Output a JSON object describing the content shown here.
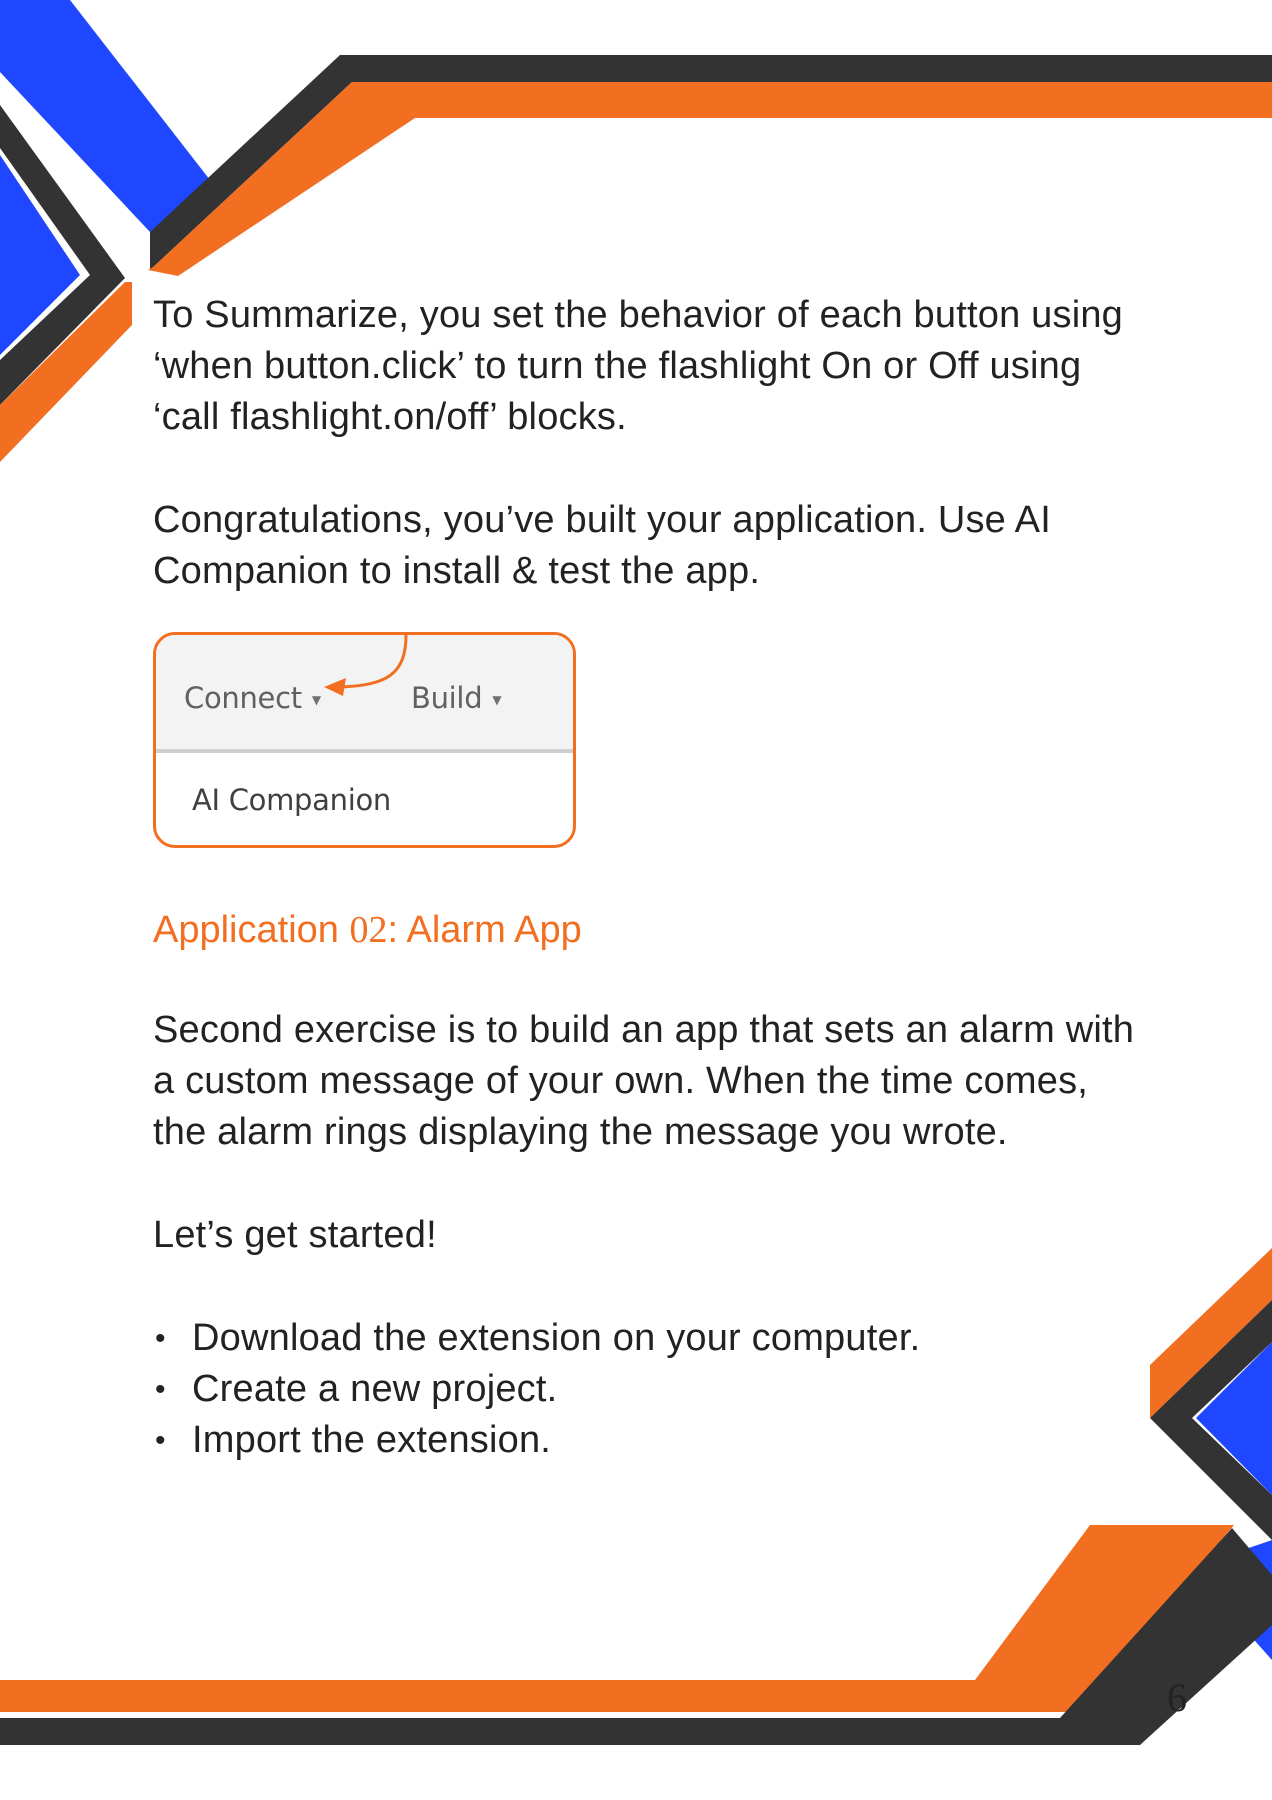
{
  "colors": {
    "orange": "#f26f21",
    "blue": "#1e47ff",
    "charcoal": "#333333",
    "text": "#222222"
  },
  "summary": {
    "lines": [
      "To Summarize, you set the behavior of each button using",
      "‘when button.click’ to turn the flashlight On or Off using",
      "‘call flashlight.on/off’ blocks."
    ]
  },
  "congrats": {
    "lines": [
      "Congratulations, you’ve built your application. Use AI",
      "Companion to install & test the app."
    ]
  },
  "menu_screenshot": {
    "connect_label": "Connect",
    "build_label": "Build",
    "caret_icon": "caret-down-icon",
    "dropdown_item": "AI Companion"
  },
  "heading": {
    "prefix": "Application ",
    "number": "02",
    "suffix": ": Alarm App"
  },
  "intro": {
    "lines": [
      "Second exercise is to build an app that sets an alarm with",
      "a custom message of your own. When the time comes,",
      "the alarm rings displaying the message you wrote."
    ]
  },
  "start": {
    "text": "Let’s get started!"
  },
  "steps": [
    "Download the extension on your computer.",
    "Create a new project.",
    "Import the extension."
  ],
  "page_number": "6"
}
